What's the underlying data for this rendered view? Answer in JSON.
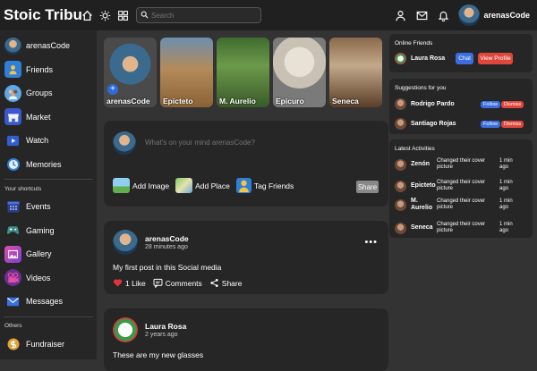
{
  "app": {
    "title": "Stoic Tribu"
  },
  "search": {
    "placeholder": "Search"
  },
  "user": {
    "name": "arenasCode"
  },
  "sidebar": {
    "items": [
      {
        "label": "arenasCode"
      },
      {
        "label": "Friends"
      },
      {
        "label": "Groups"
      },
      {
        "label": "Market"
      },
      {
        "label": "Watch"
      },
      {
        "label": "Memories"
      }
    ],
    "shortcuts_title": "Your shortcuts",
    "shortcuts": [
      {
        "label": "Events"
      },
      {
        "label": "Gaming"
      },
      {
        "label": "Gallery"
      },
      {
        "label": "Videos"
      },
      {
        "label": "Messages"
      }
    ],
    "others_title": "Others",
    "others": [
      {
        "label": "Fundraiser"
      }
    ]
  },
  "stories": [
    {
      "name": "arenasCode"
    },
    {
      "name": "Epicteto"
    },
    {
      "name": "M. Aurelio"
    },
    {
      "name": "Epicuro"
    },
    {
      "name": "Seneca"
    }
  ],
  "new_post": {
    "placeholder": "What's on your mind arenasCode?",
    "add_image": "Add Image",
    "add_place": "Add Place",
    "tag_friends": "Tag Friends",
    "share": "Share"
  },
  "posts": [
    {
      "author": "arenasCode",
      "time": "28 minutes ago",
      "text": "My first post in this Social media",
      "likes": "1 Like",
      "comments": "Comments",
      "share": "Share"
    },
    {
      "author": "Laura Rosa",
      "time": "2 years ago",
      "text": "These are my new glasses"
    }
  ],
  "online": {
    "title": "Online Friends",
    "friends": [
      {
        "name": "Laura Rosa",
        "chat": "Chat",
        "view": "View Profile"
      }
    ]
  },
  "suggestions": {
    "title": "Suggestions for you",
    "people": [
      {
        "name": "Rodrigo Pardo",
        "follow": "Follow",
        "dismiss": "Dismiss"
      },
      {
        "name": "Santiago Rojas",
        "follow": "Follow",
        "dismiss": "Dismiss"
      }
    ]
  },
  "activities": {
    "title": "Latest Activities",
    "items": [
      {
        "name": "Zenón",
        "desc": "Changed their cover picture",
        "time": "1 min ago"
      },
      {
        "name": "Epicteto",
        "desc": "Changed their cover picture",
        "time": "1 min ago"
      },
      {
        "name": "M. Aurelio",
        "desc": "Changed their cover picture",
        "time": "1 min ago"
      },
      {
        "name": "Seneca",
        "desc": "Changed their cover picture",
        "time": "1 min ago"
      }
    ]
  },
  "colors": {
    "accent": "#3b6fe0",
    "danger": "#e0473c",
    "bg": "#333333",
    "panel": "#262626",
    "topbar": "#202020"
  }
}
